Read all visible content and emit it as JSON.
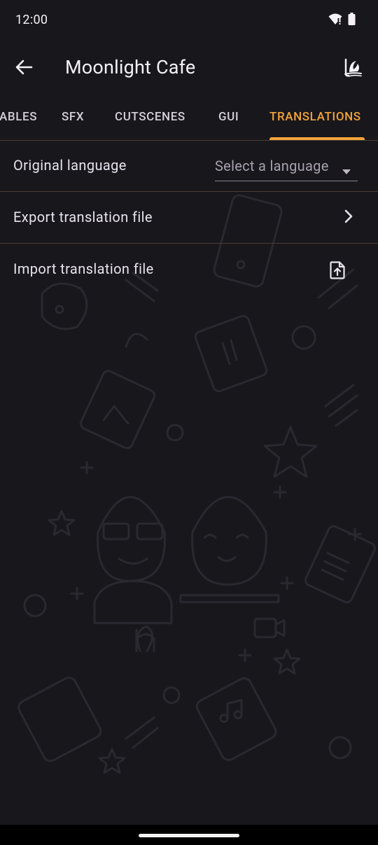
{
  "status_bar": {
    "time": "12:00"
  },
  "app_bar": {
    "title": "Moonlight Cafe"
  },
  "tabs": [
    {
      "label": "ABLES",
      "active": false
    },
    {
      "label": "SFX",
      "active": false
    },
    {
      "label": "CUTSCENES",
      "active": false
    },
    {
      "label": "GUI",
      "active": false
    },
    {
      "label": "TRANSLATIONS",
      "active": true
    }
  ],
  "settings": {
    "original_language": {
      "label": "Original language",
      "placeholder": "Select a language"
    },
    "export": {
      "label": "Export translation file"
    },
    "import": {
      "label": "Import translation file"
    }
  },
  "icons": {
    "back": "arrow-back-icon",
    "app_action": "game-logo-icon",
    "dropdown": "caret-down-icon",
    "export": "chevron-right-icon",
    "import": "file-upload-icon",
    "wifi": "wifi-icon",
    "battery": "battery-icon"
  },
  "colors": {
    "background": "#18171c",
    "accent": "#f3a43a",
    "divider": "#4a3f37",
    "text": "#e8e4ed",
    "muted_text": "#a7a2ad"
  }
}
